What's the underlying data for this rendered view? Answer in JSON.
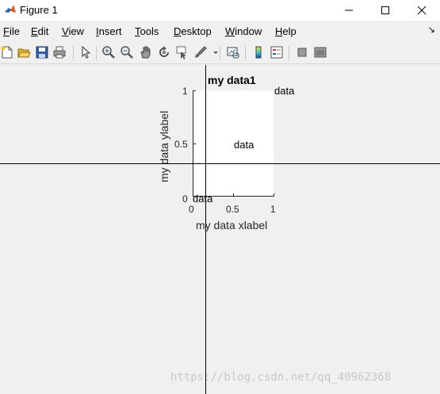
{
  "window": {
    "title": "Figure 1",
    "minimize_glyph": "—",
    "maximize_glyph": "☐",
    "close_glyph": "✕"
  },
  "menu": {
    "items": [
      {
        "underline": "F",
        "rest": "ile"
      },
      {
        "underline": "E",
        "rest": "dit"
      },
      {
        "underline": "V",
        "rest": "iew"
      },
      {
        "underline": "I",
        "rest": "nsert"
      },
      {
        "underline": "T",
        "rest": "ools"
      },
      {
        "underline": "D",
        "rest": "esktop"
      },
      {
        "underline": "W",
        "rest": "indow"
      },
      {
        "underline": "H",
        "rest": "elp"
      }
    ],
    "arrow_glyph": "↘"
  },
  "toolbar": {
    "icons": [
      "new-figure-icon",
      "open-file-icon",
      "save-icon",
      "print-icon",
      "pointer-icon",
      "zoom-in-icon",
      "zoom-out-icon",
      "pan-hand-icon",
      "rotate-3d-icon",
      "data-cursor-icon",
      "brush-icon",
      "link-plot-icon",
      "colorbar-icon",
      "legend-icon",
      "hide-plot-tools-icon",
      "show-plot-tools-icon"
    ]
  },
  "axes": {
    "title": "my data1",
    "xlabel": "my data xlabel",
    "ylabel": "my data ylabel",
    "xticks": [
      "0",
      "0.5",
      "1"
    ],
    "yticks": [
      "0",
      "0.5",
      "1"
    ],
    "xlim": [
      0,
      1
    ],
    "ylim": [
      0,
      1
    ]
  },
  "chart_data": {
    "type": "scatter",
    "title": "my data1",
    "xlabel": "my data xlabel",
    "ylabel": "my data ylabel",
    "xlim": [
      0,
      1
    ],
    "ylim": [
      0,
      1
    ],
    "annotations": [
      {
        "text": "data",
        "x": 0,
        "y": 0
      },
      {
        "text": "data",
        "x": 0.5,
        "y": 0.5
      },
      {
        "text": "data",
        "x": 1,
        "y": 1
      }
    ]
  },
  "watermark": "https://blog.csdn.net/qq_40962368"
}
